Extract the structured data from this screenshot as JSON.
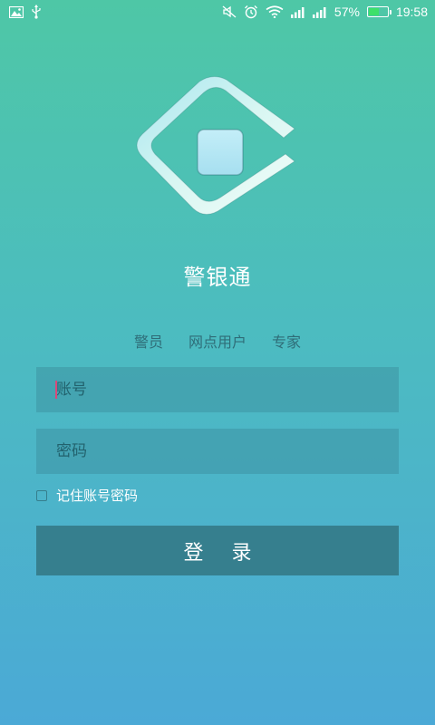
{
  "status_bar": {
    "icons_left": [
      "image-icon",
      "usb-icon"
    ],
    "icons_right": [
      "mute-icon",
      "alarm-icon",
      "wifi-icon",
      "signal-icon",
      "signal-icon"
    ],
    "battery_percent": "57%",
    "battery_level": 0.57,
    "time": "19:58"
  },
  "app": {
    "title": "警银通"
  },
  "role_tabs": [
    "警员",
    "网点用户",
    "专家"
  ],
  "form": {
    "account_placeholder": "账号",
    "account_value": "",
    "password_placeholder": "密码",
    "password_value": "",
    "remember_label": "记住账号密码",
    "remember_checked": false,
    "login_label": "登 录"
  },
  "colors": {
    "gradient_top": "#4ec7a6",
    "gradient_bottom": "#4ba9d6",
    "button": "#367f8e",
    "input_bg": "#3c8c9b",
    "cursor": "#d84a7a"
  }
}
